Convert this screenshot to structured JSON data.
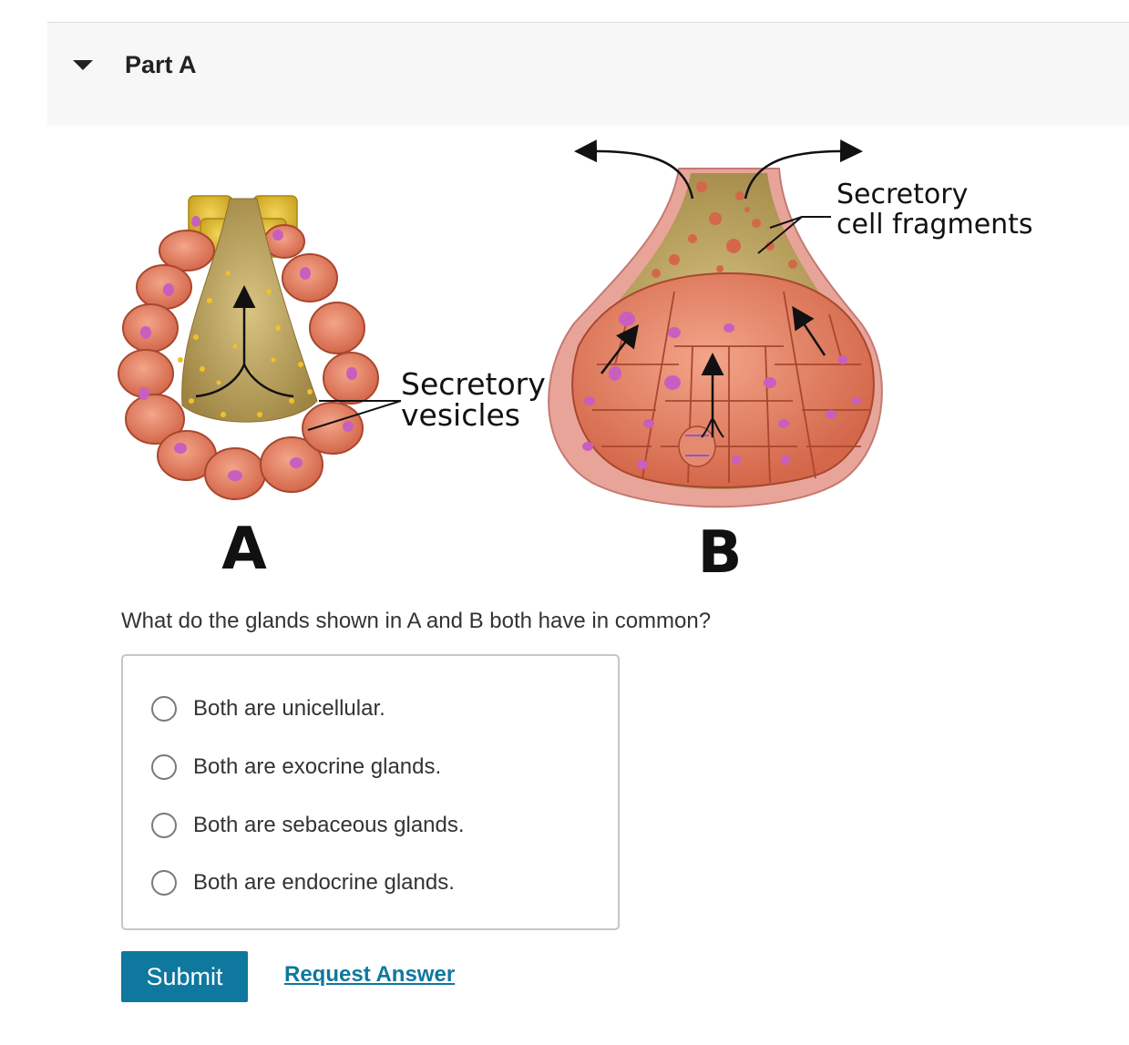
{
  "part": {
    "title": "Part A"
  },
  "figure": {
    "label_a": "A",
    "label_b": "B",
    "callout_vesicles_line1": "Secretory",
    "callout_vesicles_line2": "vesicles",
    "callout_fragments_line1": "Secretory",
    "callout_fragments_line2": "cell fragments"
  },
  "question": {
    "text": "What do the glands shown in A and B both have in common?",
    "options": [
      {
        "label": "Both are unicellular."
      },
      {
        "label": "Both are exocrine glands."
      },
      {
        "label": "Both are sebaceous glands."
      },
      {
        "label": "Both are endocrine glands."
      }
    ]
  },
  "actions": {
    "submit_label": "Submit",
    "request_answer_label": "Request Answer"
  },
  "colors": {
    "accent": "#0e789e",
    "cell": "#e07a5c",
    "nucleus": "#c85fbf",
    "lumen": "#b89b55",
    "header_bg": "#f7f7f7"
  }
}
